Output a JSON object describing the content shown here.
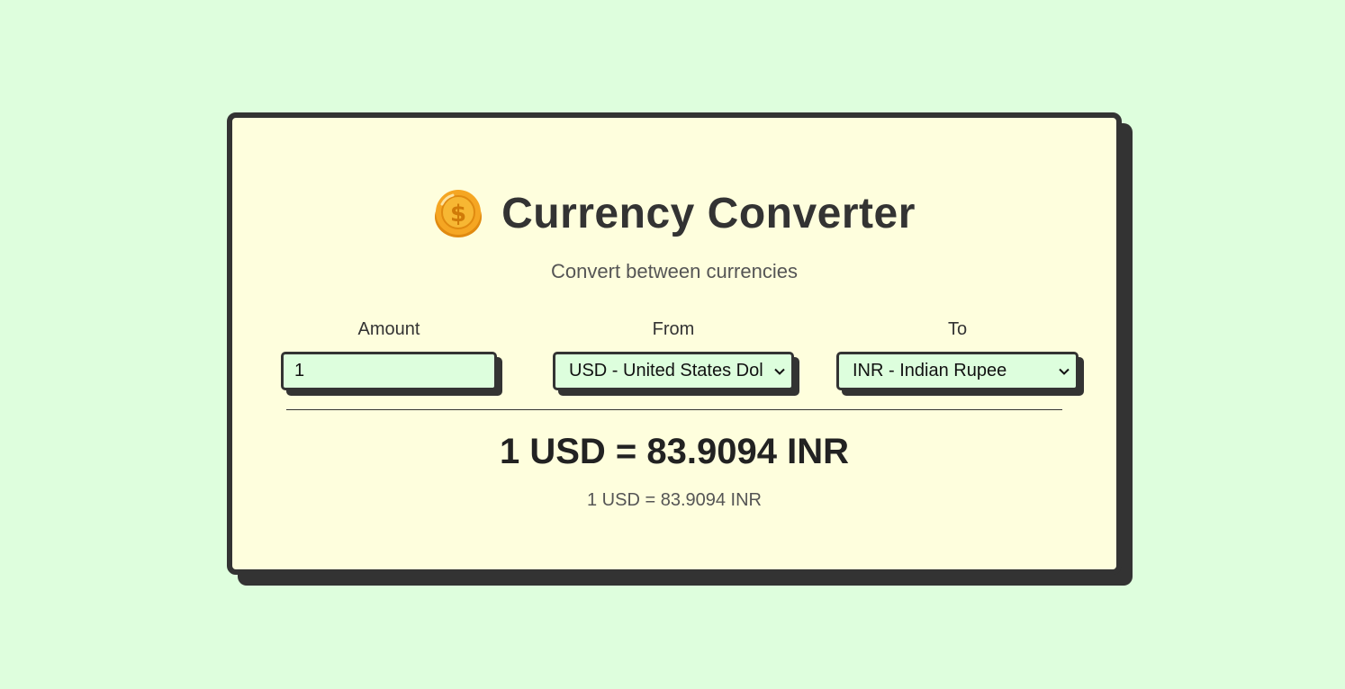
{
  "header": {
    "title": "Currency Converter",
    "subtitle": "Convert between currencies",
    "icon": "coin-icon"
  },
  "form": {
    "amount": {
      "label": "Amount",
      "value": "1"
    },
    "from": {
      "label": "From",
      "selected": "USD - United States Dol"
    },
    "to": {
      "label": "To",
      "selected": "INR - Indian Rupee"
    }
  },
  "result": {
    "main": "1 USD = 83.9094 INR",
    "rate": "1 USD = 83.9094 INR"
  },
  "colors": {
    "page_background": "#defedd",
    "card_background": "#fefedd",
    "border": "#333333",
    "input_background": "#ddfedd",
    "coin": "#f5a623"
  }
}
